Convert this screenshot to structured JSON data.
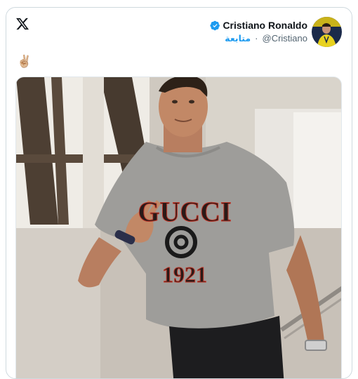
{
  "tweet": {
    "author_name": "Cristiano Ronaldo",
    "handle": "@Cristiano",
    "follow_label": "متابعة",
    "separator": "·",
    "text": "✌🏼",
    "verified_icon": "verified-badge-icon",
    "platform_icon": "x-logo-icon"
  },
  "media": {
    "shirt_brand": "GUCCI",
    "shirt_year": "1921"
  },
  "colors": {
    "accent": "#1d9bf0",
    "text": "#0f1419",
    "muted": "#536471",
    "border": "#cfd9de"
  }
}
